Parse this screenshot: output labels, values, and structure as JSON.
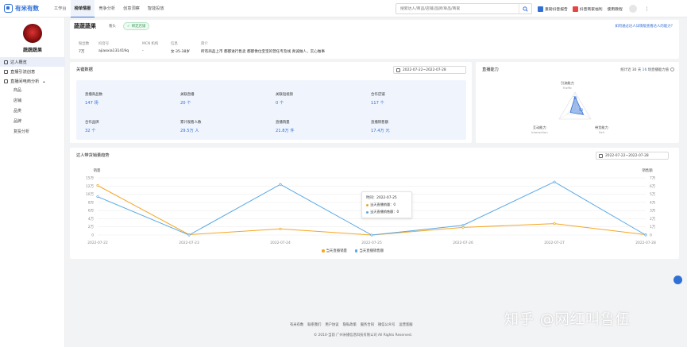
{
  "brand": {
    "name": "有米有数"
  },
  "nav": {
    "items": [
      {
        "label": "工作台",
        "active": false
      },
      {
        "label": "榜单情报",
        "active": true
      },
      {
        "label": "竞争分析",
        "active": false
      },
      {
        "label": "创意洞察",
        "active": false
      },
      {
        "label": "智能投放",
        "active": false
      }
    ]
  },
  "search": {
    "placeholder": "搜索达人/商品/店铺/品牌/单品/商家"
  },
  "header_right": {
    "items": [
      "重磅抖音报告",
      "抖音商家福利",
      "使用教程"
    ],
    "colors": [
      "#2f6fd6",
      "#e54545"
    ]
  },
  "sidebar": {
    "profile_name": "蔬蔬蔬果",
    "menu": [
      {
        "label": "达人概览",
        "active": true
      },
      {
        "label": "直播引流创意",
        "active": false
      },
      {
        "label": "直播间电商分析",
        "active": false,
        "expanded": true
      }
    ],
    "submenu": [
      "商品",
      "店铺",
      "品类",
      "品牌",
      "复投分析"
    ]
  },
  "profile": {
    "name": "蔬蔬蔬果",
    "tag": "看头",
    "badge": "绑定店铺",
    "link": "如何通过达人详情版查看达人的能力？",
    "cols": [
      {
        "label": "粉丝数",
        "value": "7万"
      },
      {
        "label": "抖音号",
        "value": "ajiaoxia131419q"
      },
      {
        "label": "MCN 机构",
        "value": "-"
      },
      {
        "label": "信息",
        "value": "女·35-38岁"
      },
      {
        "label": "简介",
        "value": "所有商品上市 都都进行售卖 都都像位宝宝的营任专及线 真诚做人，实心做事"
      }
    ]
  },
  "key_data": {
    "title": "关键数据",
    "date_range": "2022-07-22~2022-07-28",
    "metrics": [
      {
        "label": "直播商品数",
        "value": "147 场"
      },
      {
        "label": "关联直播",
        "value": "20 个"
      },
      {
        "label": "关联短视频",
        "value": "0 个"
      },
      {
        "label": "合作店铺",
        "value": "117 个"
      },
      {
        "label": "合作品牌",
        "value": "32 个"
      },
      {
        "label": "累计观看人数",
        "value": "29.5万 人"
      },
      {
        "label": "直播销量",
        "value": "21.8万 件"
      },
      {
        "label": "直播销售额",
        "value": "17.4万 元"
      }
    ]
  },
  "ability": {
    "title": "直播能力",
    "note_prefix": "统计近 30 天",
    "note_count": "16",
    "note_suffix": " 场直播能力值",
    "axes": [
      {
        "cn": "引流能力",
        "en": "Traffic",
        "value": 0.73
      },
      {
        "cn": "带货能力",
        "en": "Sell",
        "value": 0.53
      },
      {
        "cn": "互动能力",
        "en": "Interaction",
        "value": 0.3
      }
    ],
    "labels": [
      "73",
      "53"
    ]
  },
  "trend": {
    "title": "达人带货销量趋势",
    "date_range": "2022-07-22~2022-07-28",
    "left_axis_title": "销量",
    "right_axis_title": "销售额",
    "tooltip": {
      "date": "时间：2022-07-25",
      "row1": "当天直播销量：0",
      "row2": "当天直播销售额：0"
    }
  },
  "chart_data": {
    "type": "line",
    "x": [
      "2022-07-22",
      "2022-07-23",
      "2022-07-24",
      "2022-07-25",
      "2022-07-26",
      "2022-07-27",
      "2022-07-28"
    ],
    "series": [
      {
        "name": "当天直播销量",
        "axis": "left",
        "color": "#f5a623",
        "values": [
          130000,
          1000,
          16000,
          0,
          20000,
          30000,
          1000
        ]
      },
      {
        "name": "当天直播销售额",
        "axis": "right",
        "color": "#5aa9e6",
        "values": [
          47000,
          0,
          62000,
          0,
          12000,
          65000,
          0
        ]
      }
    ],
    "left_ticks": [
      "0",
      "2万",
      "4万",
      "6万",
      "8万",
      "10万",
      "12万",
      "15万"
    ],
    "right_ticks": [
      "0",
      "1万",
      "2万",
      "3万",
      "4万",
      "5万",
      "6万",
      "7万"
    ],
    "ylim_left": [
      0,
      150000
    ],
    "ylim_right": [
      0,
      70000
    ],
    "grid": true,
    "legend": "bottom"
  },
  "footer": {
    "links": [
      "有米有数",
      "联系我们",
      "用户协议",
      "隐私政策",
      "服务合同",
      "微信公众号",
      "运营客服"
    ],
    "copy": "© 2010-当前 广州米播信息科技有限公司 All Rights Reserved."
  },
  "watermark": "知乎 @网红叫鲁伍"
}
